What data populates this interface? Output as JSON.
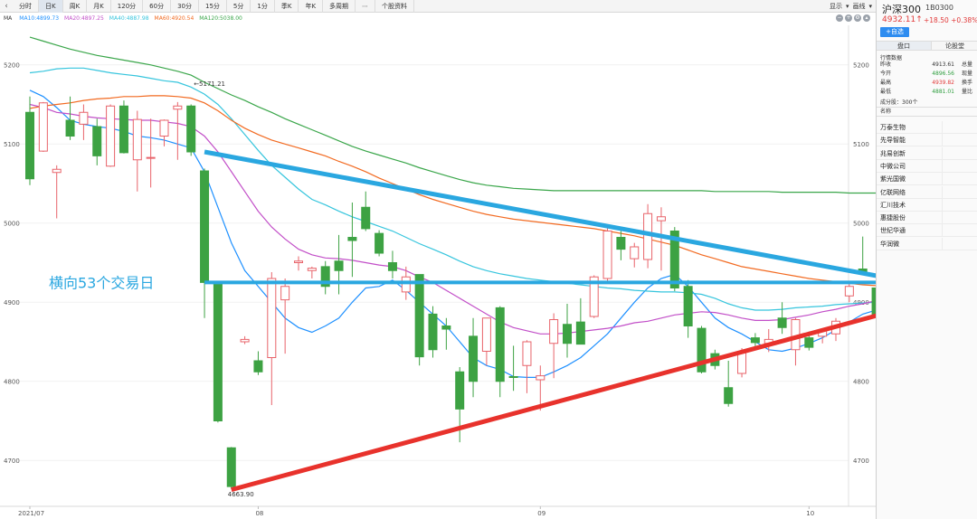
{
  "toolbar": {
    "periods": [
      "分时",
      "日K",
      "周K",
      "月K",
      "120分",
      "60分",
      "30分",
      "15分",
      "5分",
      "1分",
      "季K",
      "年K",
      "多周期",
      "⋯",
      "个股资料"
    ],
    "active": "日K",
    "right_items": [
      "显示",
      "▾",
      "画线",
      "▾"
    ]
  },
  "ma_legend": {
    "label": "MA",
    "items": [
      {
        "text": "MA10:4899.73",
        "color": "#1e90ff"
      },
      {
        "text": "MA20:4897.25",
        "color": "#c24fc8"
      },
      {
        "text": "MA40:4887.98",
        "color": "#36c5dd"
      },
      {
        "text": "MA60:4920.54",
        "color": "#f26a21"
      },
      {
        "text": "MA120:5038.00",
        "color": "#3aa64a"
      }
    ]
  },
  "chart_data": {
    "type": "candlestick",
    "y_ticks": [
      5200,
      5100,
      5000,
      4900,
      4800,
      4700
    ],
    "ylim": [
      4642,
      5250
    ],
    "x_labels": [
      {
        "text": "2021/07",
        "index": 0
      },
      {
        "text": "08",
        "index": 17
      },
      {
        "text": "09",
        "index": 38
      },
      {
        "text": "10",
        "index": 58
      }
    ],
    "candles": [
      [
        5140,
        5160,
        5048,
        5056
      ],
      [
        5091,
        5153,
        5090,
        5152
      ],
      [
        5064,
        5073,
        5006,
        5068
      ],
      [
        5130,
        5160,
        5105,
        5110
      ],
      [
        5125,
        5150,
        5105,
        5140
      ],
      [
        5122,
        5132,
        5073,
        5085
      ],
      [
        5072,
        5150,
        5071,
        5148
      ],
      [
        5148,
        5155,
        5088,
        5089
      ],
      [
        5080,
        5142,
        5040,
        5131
      ],
      [
        5082,
        5132,
        5045,
        5083
      ],
      [
        5110,
        5131,
        5097,
        5130
      ],
      [
        5144,
        5153,
        5080,
        5148
      ],
      [
        5148,
        5150,
        5085,
        5090
      ],
      [
        5066,
        5069,
        4880,
        4925
      ],
      [
        4925,
        4925,
        4748,
        4750
      ],
      [
        4716,
        4717,
        4664,
        4667
      ],
      [
        4850,
        4857,
        4847,
        4853
      ],
      [
        4826,
        4838,
        4808,
        4812
      ],
      [
        4830,
        4938,
        4770,
        4930
      ],
      [
        4903,
        4930,
        4835,
        4920
      ],
      [
        4950,
        4958,
        4940,
        4952
      ],
      [
        4940,
        4945,
        4930,
        4943
      ],
      [
        4945,
        4952,
        4910,
        4920
      ],
      [
        4952,
        4985,
        4910,
        4940
      ],
      [
        4982,
        5026,
        4932,
        4978
      ],
      [
        5020,
        5040,
        4990,
        4993
      ],
      [
        4987,
        4991,
        4958,
        4962
      ],
      [
        4950,
        4965,
        4930,
        4940
      ],
      [
        4913,
        4945,
        4903,
        4932
      ],
      [
        4935,
        4935,
        4820,
        4831
      ],
      [
        4885,
        4895,
        4830,
        4840
      ],
      [
        4870,
        4880,
        4840,
        4866
      ],
      [
        4812,
        4818,
        4723,
        4765
      ],
      [
        4857,
        4880,
        4780,
        4800
      ],
      [
        4838,
        4875,
        4820,
        4880
      ],
      [
        4893,
        4895,
        4780,
        4800
      ],
      [
        4806,
        4845,
        4788,
        4805
      ],
      [
        4820,
        4852,
        4785,
        4850
      ],
      [
        4802,
        4820,
        4763,
        4807
      ],
      [
        4848,
        4886,
        4804,
        4878
      ],
      [
        4872,
        4898,
        4830,
        4848
      ],
      [
        4875,
        4905,
        4865,
        4847
      ],
      [
        4882,
        4934,
        4880,
        4932
      ],
      [
        4930,
        4998,
        4925,
        4990
      ],
      [
        4982,
        4990,
        4953,
        4967
      ],
      [
        4955,
        4975,
        4944,
        4970
      ],
      [
        4954,
        5024,
        4943,
        5012
      ],
      [
        5003,
        5020,
        4940,
        5008
      ],
      [
        4990,
        4995,
        4914,
        4918
      ],
      [
        4920,
        4928,
        4855,
        4870
      ],
      [
        4867,
        4870,
        4810,
        4812
      ],
      [
        4835,
        4840,
        4815,
        4820
      ],
      [
        4792,
        4826,
        4768,
        4772
      ],
      [
        4810,
        4842,
        4805,
        4838
      ],
      [
        4855,
        4861,
        4843,
        4849
      ],
      [
        4848,
        4866,
        4837,
        4853
      ],
      [
        4880,
        4900,
        4860,
        4868
      ],
      [
        4840,
        4880,
        4820,
        4878
      ],
      [
        4855,
        4863,
        4839,
        4843
      ],
      [
        4857,
        4867,
        4848,
        4864
      ],
      [
        4860,
        4880,
        4851,
        4876
      ],
      [
        4908,
        4925,
        4900,
        4920
      ],
      [
        4942,
        4983,
        4937,
        4936
      ],
      [
        4918,
        4949,
        4880,
        4882
      ],
      [
        4882,
        4942,
        4855,
        4932
      ],
      [
        4932,
        4946,
        4912,
        4914
      ],
      [
        4897,
        4930,
        4890,
        4928
      ]
    ],
    "ma_lines": [
      {
        "name": "MA10",
        "color": "#1e90ff",
        "values": [
          5168,
          5160,
          5146,
          5130,
          5125,
          5122,
          5120,
          5116,
          5110,
          5108,
          5105,
          5100,
          5095,
          5065,
          5020,
          4975,
          4940,
          4920,
          4900,
          4880,
          4868,
          4862,
          4870,
          4880,
          4900,
          4918,
          4920,
          4928,
          4915,
          4900,
          4885,
          4870,
          4850,
          4830,
          4820,
          4815,
          4806,
          4805,
          4805,
          4812,
          4820,
          4830,
          4845,
          4860,
          4880,
          4900,
          4918,
          4930,
          4935,
          4920,
          4900,
          4880,
          4868,
          4860,
          4850,
          4840,
          4838,
          4842,
          4848,
          4855,
          4865,
          4875,
          4885,
          4890,
          4892,
          4895,
          4890
        ]
      },
      {
        "name": "MA40",
        "color": "#36c5dd",
        "values": [
          5190,
          5192,
          5195,
          5196,
          5196,
          5193,
          5190,
          5188,
          5186,
          5183,
          5180,
          5178,
          5172,
          5163,
          5150,
          5132,
          5112,
          5092,
          5073,
          5058,
          5043,
          5030,
          5023,
          5015,
          5008,
          5002,
          4996,
          4990,
          4982,
          4974,
          4967,
          4960,
          4952,
          4945,
          4940,
          4936,
          4933,
          4930,
          4928,
          4926,
          4924,
          4922,
          4920,
          4918,
          4917,
          4915,
          4914,
          4913,
          4913,
          4912,
          4910,
          4905,
          4898,
          4893,
          4890,
          4890,
          4891,
          4893,
          4894,
          4895,
          4897,
          4898,
          4899,
          4900,
          4901,
          4903,
          4903
        ]
      },
      {
        "name": "MA20",
        "color": "#c24fc8",
        "values": [
          5150,
          5146,
          5140,
          5138,
          5135,
          5133,
          5132,
          5131,
          5130,
          5130,
          5128,
          5126,
          5122,
          5110,
          5090,
          5065,
          5040,
          5015,
          4995,
          4980,
          4967,
          4960,
          4956,
          4955,
          4953,
          4950,
          4947,
          4945,
          4940,
          4932,
          4925,
          4915,
          4905,
          4895,
          4885,
          4875,
          4868,
          4864,
          4860,
          4860,
          4861,
          4863,
          4865,
          4867,
          4870,
          4874,
          4876,
          4880,
          4884,
          4886,
          4888,
          4887,
          4884,
          4880,
          4877,
          4877,
          4878,
          4881,
          4884,
          4888,
          4891,
          4895,
          4898,
          4902,
          4905,
          4908,
          4906
        ]
      },
      {
        "name": "MA60",
        "color": "#f26a21",
        "values": [
          5145,
          5148,
          5150,
          5152,
          5155,
          5157,
          5158,
          5160,
          5160,
          5161,
          5161,
          5160,
          5158,
          5152,
          5142,
          5130,
          5120,
          5112,
          5105,
          5100,
          5095,
          5090,
          5085,
          5078,
          5072,
          5065,
          5057,
          5050,
          5043,
          5036,
          5030,
          5025,
          5020,
          5015,
          5011,
          5008,
          5005,
          5003,
          5001,
          4999,
          4997,
          4995,
          4993,
          4990,
          4987,
          4984,
          4980,
          4976,
          4972,
          4966,
          4960,
          4955,
          4950,
          4945,
          4942,
          4939,
          4936,
          4933,
          4930,
          4928,
          4926,
          4924,
          4922,
          4921,
          4920,
          4920,
          4920
        ]
      },
      {
        "name": "MA120",
        "color": "#3aa64a",
        "values": [
          5235,
          5230,
          5225,
          5220,
          5216,
          5212,
          5209,
          5206,
          5203,
          5200,
          5196,
          5192,
          5187,
          5178,
          5170,
          5162,
          5155,
          5147,
          5140,
          5132,
          5125,
          5118,
          5111,
          5104,
          5097,
          5091,
          5086,
          5081,
          5076,
          5070,
          5065,
          5060,
          5055,
          5051,
          5048,
          5046,
          5044,
          5043,
          5042,
          5041,
          5041,
          5041,
          5041,
          5041,
          5041,
          5041,
          5041,
          5041,
          5041,
          5041,
          5041,
          5040,
          5040,
          5040,
          5040,
          5040,
          5039,
          5039,
          5039,
          5039,
          5039,
          5038,
          5038,
          5038,
          5038,
          5038,
          5038
        ]
      }
    ],
    "annotations": [
      {
        "text": "←5171.21",
        "index": 12,
        "value": 5171.21
      },
      {
        "text": "4663.90",
        "index": 15,
        "value": 4663.9
      }
    ],
    "overlay_label": "横向53个交易日",
    "trendlines": [
      {
        "color": "#2aa7e0",
        "from": [
          13,
          5090
        ],
        "to": [
          80,
          4913
        ]
      },
      {
        "color": "#2aa7e0",
        "from": [
          13,
          4925
        ],
        "to": [
          66,
          4925
        ]
      },
      {
        "color": "#e8322c",
        "from": [
          15,
          4663
        ],
        "to": [
          80,
          4913
        ]
      }
    ]
  },
  "panel": {
    "name": "沪深300",
    "code": "1B0300",
    "price": "4932.11↑",
    "change": "+18.50  +0.38%",
    "watch_button": "+自选",
    "tabs": [
      "盘口",
      "论股堂"
    ],
    "market_title": "行情数据",
    "quotes": [
      {
        "label": "昨收",
        "value": "4913.61",
        "extra": "总量",
        "color": "#333333"
      },
      {
        "label": "今开",
        "value": "4896.56",
        "extra": "现量",
        "color": "#2f9e3f"
      },
      {
        "label": "最高",
        "value": "4939.82",
        "extra": "换手",
        "color": "#e23b3b"
      },
      {
        "label": "最低",
        "value": "4881.01",
        "extra": "量比",
        "color": "#2f9e3f"
      }
    ],
    "constituent_count": "成分股：300个",
    "name_header": "名称",
    "stocks": [
      "万泰生物",
      "先导智能",
      "兆易创新",
      "中微公司",
      "紫光国微",
      "亿联网络",
      "汇川技术",
      "惠捷股份",
      "世纪华通",
      "华润微"
    ]
  }
}
